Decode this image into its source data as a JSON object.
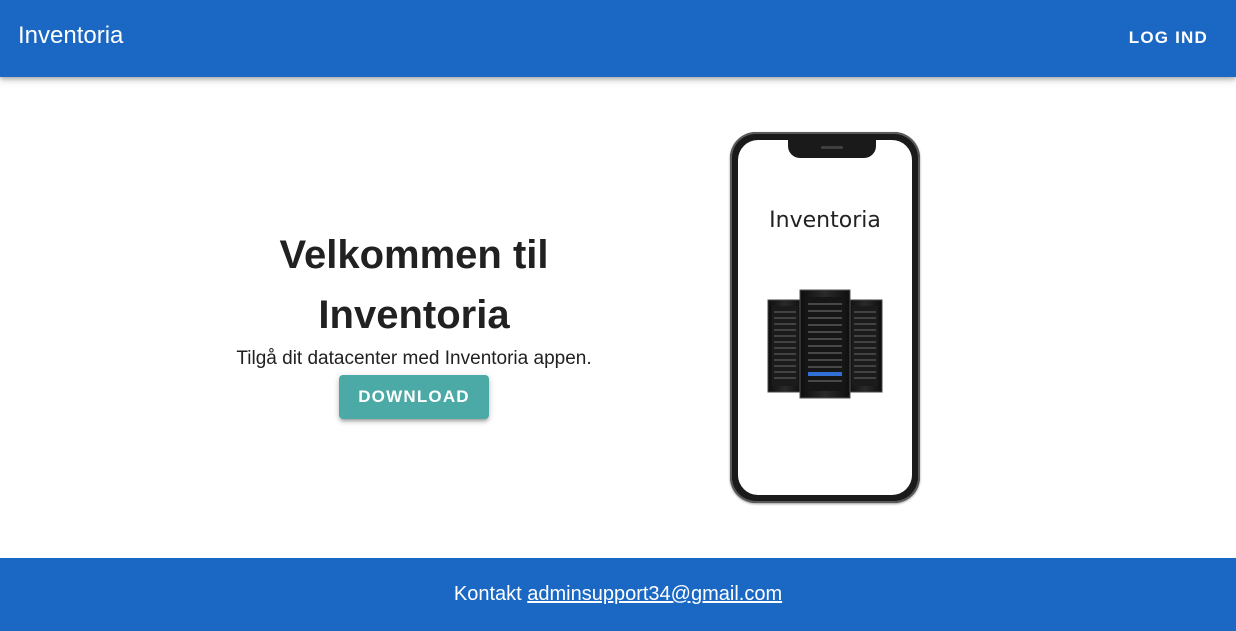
{
  "appbar": {
    "title": "Inventoria",
    "login_label": "LOG IND",
    "color": "#1a68c3"
  },
  "hero": {
    "title_line1": "Velkommen til",
    "title_line2": "Inventoria",
    "subtitle": "Tilgå dit datacenter med Inventoria appen.",
    "download_label": "DOWNLOAD",
    "button_color": "#4caaa6"
  },
  "phone": {
    "screen_label": "Inventoria",
    "image_icon": "server-racks-icon"
  },
  "footer": {
    "contact_label": "Kontakt",
    "email": "adminsupport34@gmail.com"
  }
}
